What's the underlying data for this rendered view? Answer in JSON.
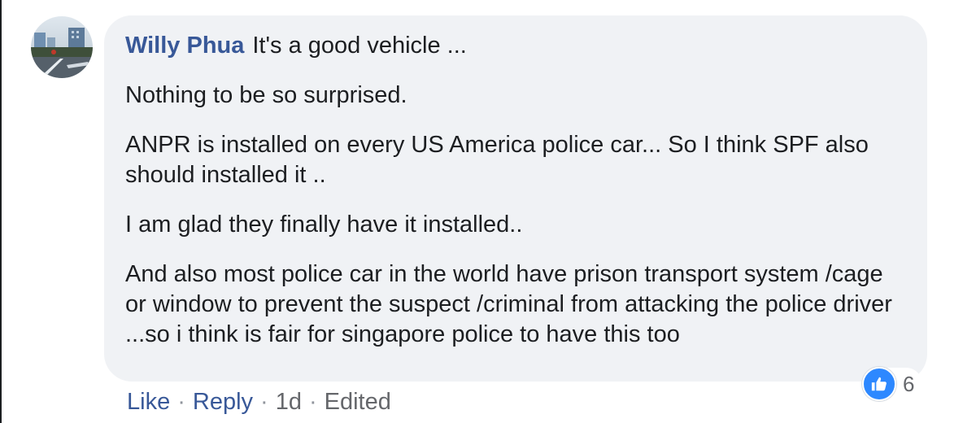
{
  "comment": {
    "author": "Willy Phua",
    "paragraphs": [
      "It's a good vehicle ...",
      "Nothing to be so surprised.",
      "ANPR is installed on every US America police car... So I think SPF also should installed it ..",
      "I am glad they finally have it installed..",
      "And also most police car in the world have prison transport system /cage or window to prevent the suspect /criminal from attacking the police driver ...so i think is fair for singapore police to have this too"
    ]
  },
  "reactions": {
    "icon": "thumbs-up-icon",
    "count": "6",
    "color": "#2d88ff"
  },
  "actions": {
    "like_label": "Like",
    "reply_label": "Reply",
    "separator": "·",
    "time": "1d",
    "edited": "Edited"
  },
  "colors": {
    "author": "#385898",
    "bubble": "#f0f2f5",
    "text": "#1c1e21",
    "meta": "#65676b"
  }
}
